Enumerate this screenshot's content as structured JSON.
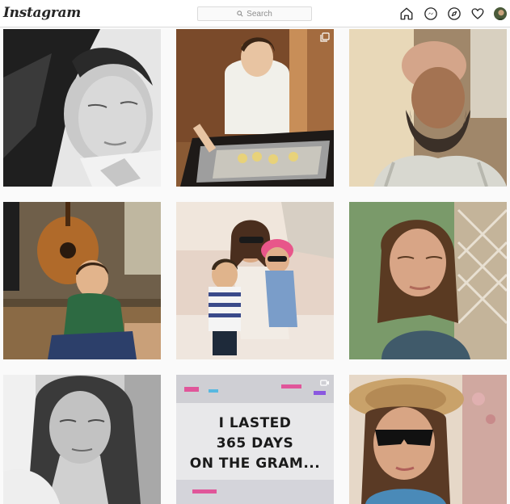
{
  "header": {
    "logo": "Instagram",
    "search_placeholder": "Search",
    "icons": [
      "home-icon",
      "messenger-icon",
      "explore-compass-icon",
      "heart-activity-icon",
      "profile-avatar"
    ]
  },
  "posts": [
    {
      "badge": null
    },
    {
      "badge": "carousel-icon"
    },
    {
      "badge": null
    },
    {
      "badge": null
    },
    {
      "badge": null
    },
    {
      "badge": null
    },
    {
      "badge": null
    },
    {
      "badge": "video-icon",
      "overlay_lines": [
        "I LASTED",
        "365 DAYS",
        "ON THE GRAM..."
      ]
    },
    {
      "badge": null
    }
  ],
  "colors": {
    "accent": "#262626",
    "border": "#dbdbdb",
    "page_bg": "#fafafa"
  }
}
